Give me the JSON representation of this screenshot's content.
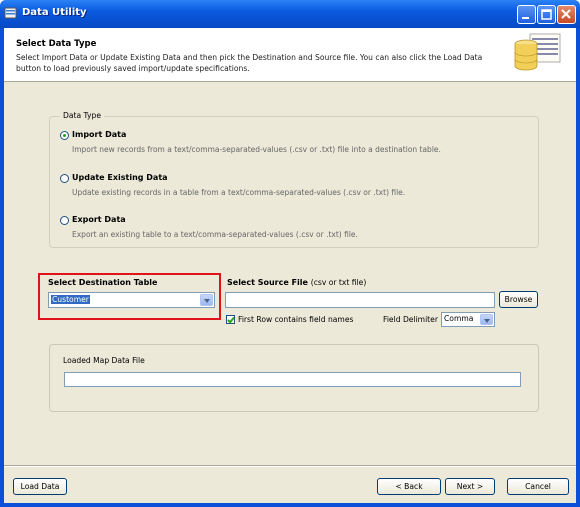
{
  "window": {
    "title": "Data Utility"
  },
  "header": {
    "title": "Select Data Type",
    "description": "Select Import Data or Update Existing Data and then pick the Destination and Source file.  You can also click the Load Data button to load previously saved import/update specifications."
  },
  "data_type": {
    "legend": "Data Type",
    "options": [
      {
        "label": "Import Data",
        "description": "Import new records from a text/comma-separated-values (.csv or .txt) file into a destination table.",
        "checked": true
      },
      {
        "label": "Update Existing Data",
        "description": "Update existing records in a table from a text/comma-separated-values (.csv or .txt) file.",
        "checked": false
      },
      {
        "label": "Export Data",
        "description": "Export an existing table to a text/comma-separated-values (.csv or .txt) file.",
        "checked": false
      }
    ]
  },
  "destination": {
    "label": "Select Destination Table",
    "value": "Customer"
  },
  "source": {
    "label": "Select Source File",
    "label_hint": "(csv or txt file)",
    "value": "",
    "browse_label": "Browse",
    "first_row_label": "First Row contains field names",
    "first_row_checked": true,
    "delimiter_label": "Field Delimiter",
    "delimiter_value": "Comma"
  },
  "map": {
    "label": "Loaded Map Data File",
    "value": ""
  },
  "footer": {
    "load_label": "Load Data",
    "back_label": "< Back",
    "next_label": "Next >",
    "cancel_label": "Cancel"
  },
  "colors": {
    "title_bar": "#0a5ae0",
    "dialog_bg": "#ece9d8",
    "highlight_border": "#e0121a",
    "selection": "#316ac5"
  }
}
